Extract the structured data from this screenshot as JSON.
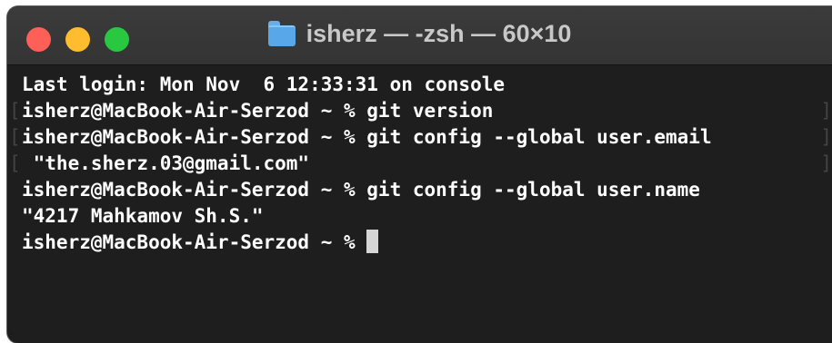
{
  "window": {
    "title": "isherz — -zsh — 60×10",
    "title_icon": "folder-icon",
    "traffic_lights": {
      "close_color": "#fe5f57",
      "minimize_color": "#febc2e",
      "zoom_color": "#28c840"
    }
  },
  "terminal": {
    "lines": [
      {
        "text": "Last login: Mon Nov  6 12:33:31 on console"
      },
      {
        "text": "isherz@MacBook-Air-Serzod ~ % git version"
      },
      {
        "text": "isherz@MacBook-Air-Serzod ~ % git config --global user.email"
      },
      {
        "text": " \"the.sherz.03@gmail.com\""
      },
      {
        "text": "isherz@MacBook-Air-Serzod ~ % git config --global user.name"
      },
      {
        "text": "\"4217 Mahkamov Sh.S.\""
      }
    ],
    "prompt": "isherz@MacBook-Air-Serzod ~ % ",
    "mark_open": "[",
    "mark_close": "]",
    "background": "#1e1e1e",
    "foreground": "#ffffff"
  }
}
